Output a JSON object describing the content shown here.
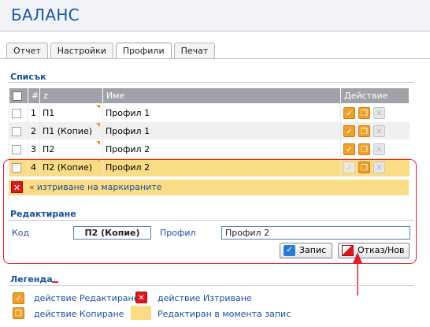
{
  "app": {
    "title": "БАЛАНС"
  },
  "tabs": [
    {
      "label": "Отчет",
      "active": false
    },
    {
      "label": "Настройки",
      "active": false
    },
    {
      "label": "Профили",
      "active": true
    },
    {
      "label": "Печат",
      "active": false
    }
  ],
  "list": {
    "title": "Списък",
    "columns": {
      "num": "#",
      "z": "z",
      "name": "Име",
      "action": "Действие"
    },
    "rows": [
      {
        "num": "1",
        "z": "П1",
        "name": "Профил 1",
        "state": "normal"
      },
      {
        "num": "2",
        "z": "П1 (Копие)",
        "name": "Профил 1",
        "state": "normal"
      },
      {
        "num": "3",
        "z": "П2",
        "name": "Профил 2",
        "state": "normal"
      },
      {
        "num": "4",
        "z": "П2 (Копие)",
        "name": "Профил 2",
        "state": "editing"
      }
    ],
    "delete_marked": "изтриване на маркираните",
    "delete_prefix": "«"
  },
  "edit": {
    "title": "Редактиране",
    "code_label": "Код",
    "code_value": "П2 (Копие)",
    "profile_label": "Профил",
    "profile_value": "Профил 2",
    "save_label": "Запис",
    "cancel_label": "Отказ/Нов"
  },
  "legend": {
    "title": "Легенда",
    "edit_action": "действие Редактиране",
    "delete_action": "действие Изтриване",
    "copy_action": "действие Копиране",
    "edited_state": "Редактиран в момента запис"
  },
  "colors": {
    "accent_blue": "#1a4f99",
    "highlight": "#fbdc86",
    "action_orange": "#efa12b",
    "delete_red": "#d8191f",
    "frame_red": "#dd2030"
  }
}
